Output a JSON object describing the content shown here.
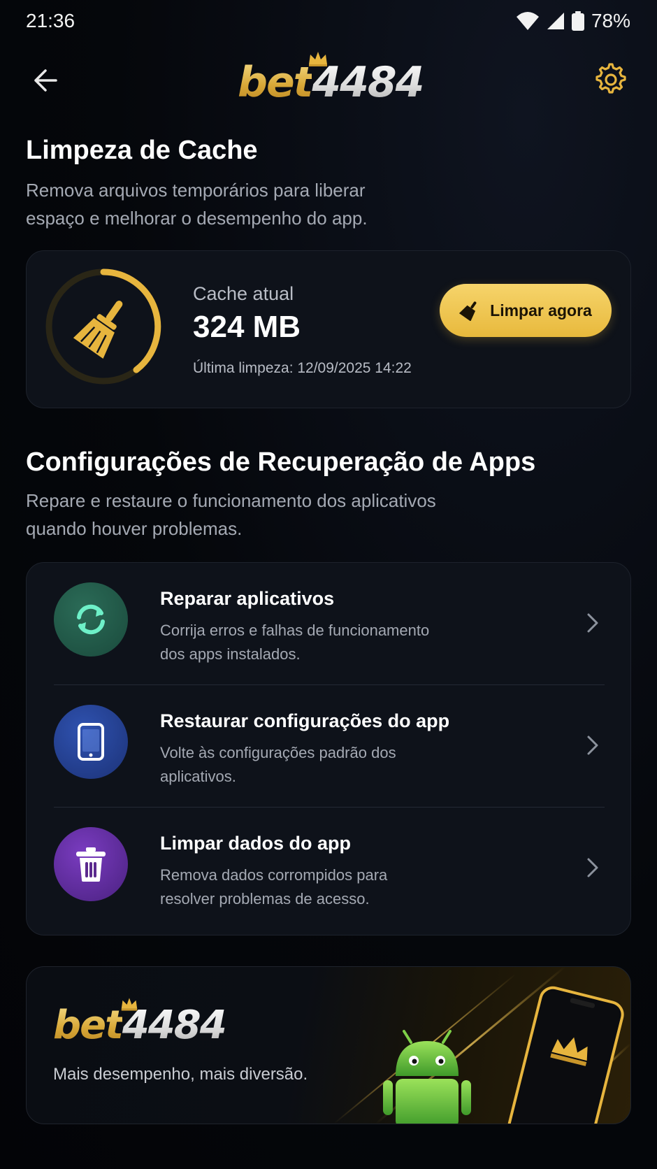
{
  "status_bar": {
    "time": "21:36",
    "battery": "78%"
  },
  "header": {
    "logo_bet": "bet",
    "logo_number": "4484",
    "back_icon": "arrow-left-icon",
    "settings_icon": "gear-icon"
  },
  "cache_section": {
    "title": "Limpeza de Cache",
    "description_line1": "Remova arquivos temporários para liberar",
    "description_line2": "espaço e melhorar o desempenho do app.",
    "label": "Cache atual",
    "value": "324 MB",
    "last_clean": "Última limpeza: 12/09/2025 14:22",
    "button_label": "Limpar agora",
    "accent": "#e8b93c"
  },
  "recovery_section": {
    "title": "Configurações de Recuperação de Apps",
    "description_line1": "Repare e restaure o funcionamento dos aplicativos",
    "description_line2": "quando houver problemas.",
    "items": [
      {
        "title": "Reparar aplicativos",
        "desc_line1": "Corrija erros e falhas de funcionamento",
        "desc_line2": "dos apps instalados.",
        "icon": "refresh-icon",
        "color": "#1f5a48"
      },
      {
        "title": "Restaurar configurações do app",
        "desc_line1": "Volte às configurações padrão dos",
        "desc_line2": "aplicativos.",
        "icon": "phone-icon",
        "color": "#233d8c"
      },
      {
        "title": "Limpar dados do app",
        "desc_line1": "Remova dados corrompidos para",
        "desc_line2": "resolver problemas de acesso.",
        "icon": "trash-icon",
        "color": "#5b2a8e"
      }
    ]
  },
  "promo": {
    "logo_bet": "bet",
    "logo_number": "4484",
    "tagline": "Mais desempenho, mais diversão."
  }
}
